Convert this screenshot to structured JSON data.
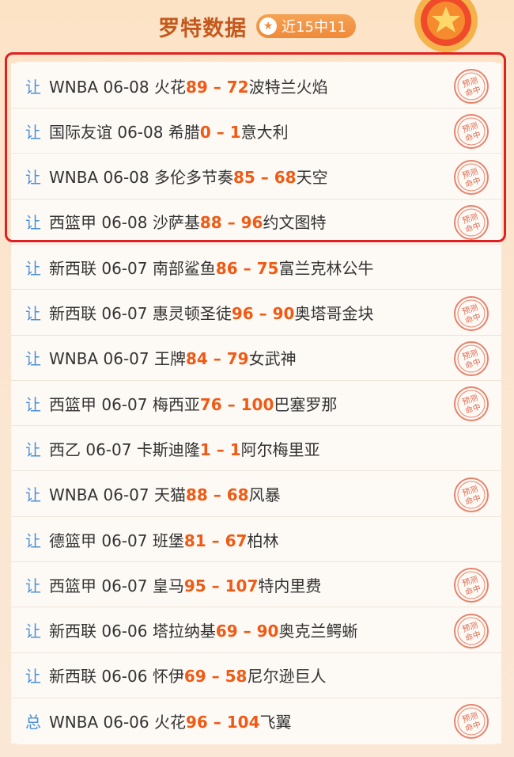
{
  "header": {
    "title": "罗特数据",
    "badge": "近15中11"
  },
  "colors": {
    "accent": "#f05a14",
    "type_blue": "#4a8fd6",
    "highlight": "#e02020"
  },
  "stamp_text": "预测命中",
  "rows": [
    {
      "type": "让",
      "league": "WNBA",
      "date": "06-08",
      "home": "火花",
      "home_score": "89",
      "sep": " – ",
      "away_score": "72",
      "away": "波特兰火焰",
      "hit": true
    },
    {
      "type": "让",
      "league": "国际友谊",
      "date": "06-08",
      "home": "希腊",
      "home_score": "0",
      "sep": " – ",
      "away_score": "1",
      "away": "意大利",
      "hit": true
    },
    {
      "type": "让",
      "league": "WNBA",
      "date": "06-08",
      "home": "多伦多节奏",
      "home_score": "85",
      "sep": " – ",
      "away_score": "68",
      "away": "天空",
      "hit": true
    },
    {
      "type": "让",
      "league": "西篮甲",
      "date": "06-08",
      "home": "沙萨基",
      "home_score": "88",
      "sep": " – ",
      "away_score": "96",
      "away": "约文图特",
      "hit": true
    },
    {
      "type": "让",
      "league": "新西联",
      "date": "06-07",
      "home": "南部鲨鱼",
      "home_score": "86",
      "sep": " – ",
      "away_score": "75",
      "away": "富兰克林公牛",
      "hit": false
    },
    {
      "type": "让",
      "league": "新西联",
      "date": "06-07",
      "home": "惠灵顿圣徒",
      "home_score": "96",
      "sep": " – ",
      "away_score": "90",
      "away": "奥塔哥金块",
      "hit": true
    },
    {
      "type": "让",
      "league": "WNBA",
      "date": "06-07",
      "home": "王牌",
      "home_score": "84",
      "sep": " – ",
      "away_score": "79",
      "away": "女武神",
      "hit": true
    },
    {
      "type": "让",
      "league": "西篮甲",
      "date": "06-07",
      "home": "梅西亚",
      "home_score": "76",
      "sep": " – ",
      "away_score": "100",
      "away": "巴塞罗那",
      "hit": true
    },
    {
      "type": "让",
      "league": "西乙",
      "date": "06-07",
      "home": "卡斯迪隆",
      "home_score": "1",
      "sep": " – ",
      "away_score": "1",
      "away": "阿尔梅里亚",
      "hit": false
    },
    {
      "type": "让",
      "league": "WNBA",
      "date": "06-07",
      "home": "天猫",
      "home_score": "88",
      "sep": " – ",
      "away_score": "68",
      "away": "风暴",
      "hit": true
    },
    {
      "type": "让",
      "league": "德篮甲",
      "date": "06-07",
      "home": "班堡",
      "home_score": "81",
      "sep": " – ",
      "away_score": "67",
      "away": "柏林",
      "hit": false
    },
    {
      "type": "让",
      "league": "西篮甲",
      "date": "06-07",
      "home": "皇马",
      "home_score": "95",
      "sep": " – ",
      "away_score": "107",
      "away": "特内里费",
      "hit": true
    },
    {
      "type": "让",
      "league": "新西联",
      "date": "06-06",
      "home": "塔拉纳基",
      "home_score": "69",
      "sep": " – ",
      "away_score": "90",
      "away": "奥克兰鳄蜥",
      "hit": true
    },
    {
      "type": "让",
      "league": "新西联",
      "date": "06-06",
      "home": "怀伊",
      "home_score": "69",
      "sep": " – ",
      "away_score": "58",
      "away": "尼尔逊巨人",
      "hit": false
    },
    {
      "type": "总",
      "league": "WNBA",
      "date": "06-06",
      "home": "火花",
      "home_score": "96",
      "sep": " – ",
      "away_score": "104",
      "away": "飞翼",
      "hit": true
    }
  ]
}
